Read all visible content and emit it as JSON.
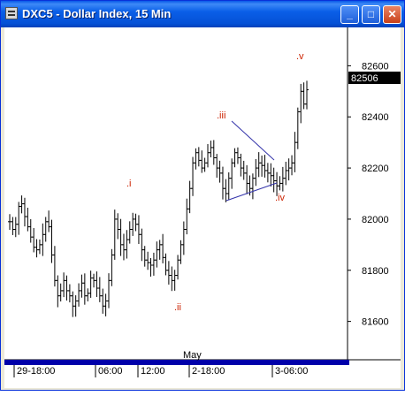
{
  "window": {
    "title": "DXC5 - Dollar Index, 15 Min",
    "min_glyph": "_",
    "max_glyph": "□",
    "close_glyph": "✕"
  },
  "colors": {
    "bars": "#000000",
    "wave_labels": "#cc2200",
    "triangle_lines": "#3333aa",
    "axis_bar": "#0000aa"
  },
  "chart": {
    "price_axis": [
      "82600",
      "82400",
      "82200",
      "82000",
      "81800",
      "81600"
    ],
    "last_price": "82506",
    "time_labels": [
      "29-18:00",
      "06:00",
      "12:00",
      "2-18:00",
      "3-06:00"
    ],
    "month_label": "May",
    "wave_labels": {
      "i": ".i",
      "ii": ".ii",
      "iii": ".iii",
      "iv": ".iv",
      "v": ".v"
    }
  },
  "chart_data": {
    "type": "ohlc",
    "title": "DXC5 - Dollar Index, 15 Min",
    "ylim": [
      81450,
      82750
    ],
    "x_tick_labels": [
      "29-18:00",
      "06:00",
      "12:00",
      "2-18:00",
      "3-06:00"
    ],
    "y_tick_labels": [
      82600,
      82400,
      82200,
      82000,
      81800,
      81600
    ],
    "last_price": 82506,
    "close_path": [
      81990,
      81960,
      81980,
      82050,
      82060,
      82010,
      81970,
      81930,
      81890,
      81880,
      81900,
      81940,
      81990,
      81970,
      81860,
      81760,
      81700,
      81720,
      81760,
      81720,
      81700,
      81660,
      81680,
      81720,
      81750,
      81700,
      81710,
      81770,
      81760,
      81730,
      81700,
      81660,
      81680,
      81760,
      81860,
      82000,
      81960,
      81900,
      81880,
      81920,
      81960,
      82000,
      81980,
      81940,
      81880,
      81840,
      81830,
      81820,
      81840,
      81880,
      81900,
      81850,
      81800,
      81780,
      81760,
      81780,
      81840,
      81900,
      81960,
      82040,
      82120,
      82220,
      82260,
      82230,
      82200,
      82220,
      82260,
      82280,
      82240,
      82200,
      82180,
      82120,
      82100,
      82160,
      82220,
      82260,
      82240,
      82200,
      82180,
      82140,
      82120,
      82160,
      82200,
      82220,
      82210,
      82190,
      82180,
      82170,
      82150,
      82130,
      82140,
      82160,
      82190,
      82200,
      82220,
      82300,
      82420,
      82500,
      82450,
      82506
    ]
  }
}
